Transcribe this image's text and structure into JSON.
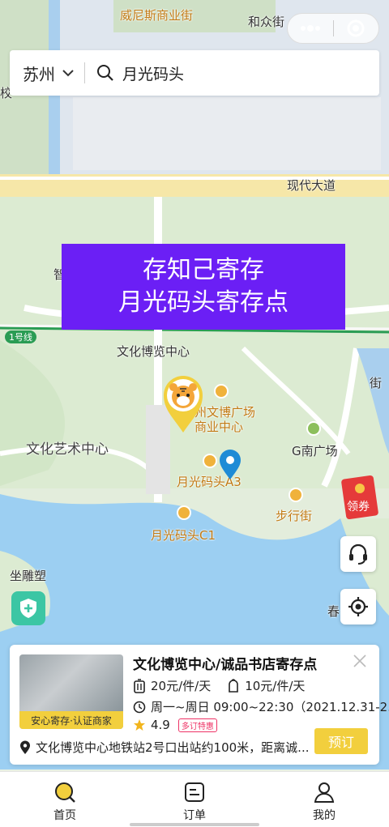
{
  "map": {
    "labels": {
      "weinisi": "威尼斯商业街",
      "hezhong": "和众街",
      "xiandai": "现代大道",
      "line1": "1号线",
      "bolan": "文化博览中心",
      "yishu": "文化艺术中心",
      "wenbo": "州文博广场",
      "shangye": "商业中心",
      "gnan": "G南广场",
      "a3": "月光码头A3",
      "c1": "月光码头C1",
      "buxing": "步行街",
      "diaosu": "坐雕塑",
      "chun": "春",
      "jiao": "校",
      "zhi": "智",
      "shi": "街"
    }
  },
  "search": {
    "city": "苏州",
    "query": "月光码头"
  },
  "banner": {
    "line1": "存知己寄存",
    "line2": "月光码头寄存点"
  },
  "coupon": {
    "label": "领券"
  },
  "card": {
    "title": "文化博览中心/诚品书店寄存点",
    "thumb_tag": "安心寄存·认证商家",
    "price_piece": "20元/件/天",
    "price_bag": "10元/件/天",
    "hours": "周一~周日 09:00~22:30（2021.12.31-2...",
    "rating": "4.9",
    "rating_badge": "多订特惠",
    "address": "文化博览中心地铁站2号口出站约100米，距离诚...",
    "book_label": "预订"
  },
  "tabs": [
    {
      "label": "首页"
    },
    {
      "label": "订单"
    },
    {
      "label": "我的"
    }
  ],
  "colors": {
    "accent": "#f2cf3d",
    "banner": "#6b1ff5",
    "pin": "#1e8bd6"
  }
}
